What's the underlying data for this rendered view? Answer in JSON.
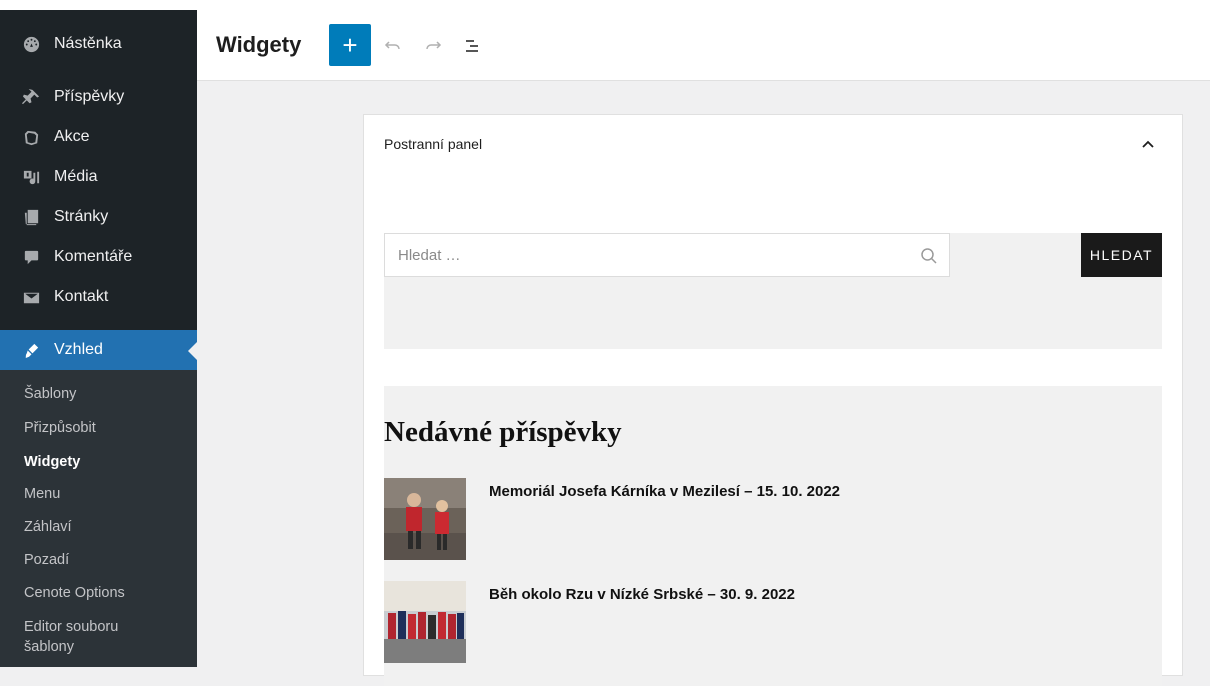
{
  "sidebar": {
    "items": [
      {
        "label": "Nástěnka",
        "icon": "dashboard-icon"
      },
      {
        "label": "Příspěvky",
        "icon": "pin-icon"
      },
      {
        "label": "Akce",
        "icon": "events-icon"
      },
      {
        "label": "Média",
        "icon": "media-icon"
      },
      {
        "label": "Stránky",
        "icon": "pages-icon"
      },
      {
        "label": "Komentáře",
        "icon": "comments-icon"
      },
      {
        "label": "Kontakt",
        "icon": "mail-icon"
      },
      {
        "label": "Vzhled",
        "icon": "appearance-icon",
        "active": true
      }
    ],
    "submenu": [
      {
        "label": "Šablony"
      },
      {
        "label": "Přizpůsobit"
      },
      {
        "label": "Widgety",
        "current": true
      },
      {
        "label": "Menu"
      },
      {
        "label": "Záhlaví"
      },
      {
        "label": "Pozadí"
      },
      {
        "label": "Cenote Options"
      },
      {
        "label": "Editor souboru"
      },
      {
        "label": "šablony"
      }
    ]
  },
  "header": {
    "title": "Widgety",
    "add_label": "+"
  },
  "panel": {
    "title": "Postranní panel",
    "search": {
      "placeholder": "Hledat …",
      "button_label": "HLEDAT"
    },
    "recent": {
      "title": "Nedávné příspěvky",
      "posts": [
        {
          "title": "Memoriál Josefa Kárníka v Mezilesí – 15. 10. 2022"
        },
        {
          "title": "Běh okolo Rzu v Nízké Srbské – 30. 9. 2022"
        }
      ]
    }
  },
  "colors": {
    "sidebar_bg": "#1d2327",
    "submenu_bg": "#2c3338",
    "accent": "#2271b1",
    "add_button": "#007cba"
  }
}
